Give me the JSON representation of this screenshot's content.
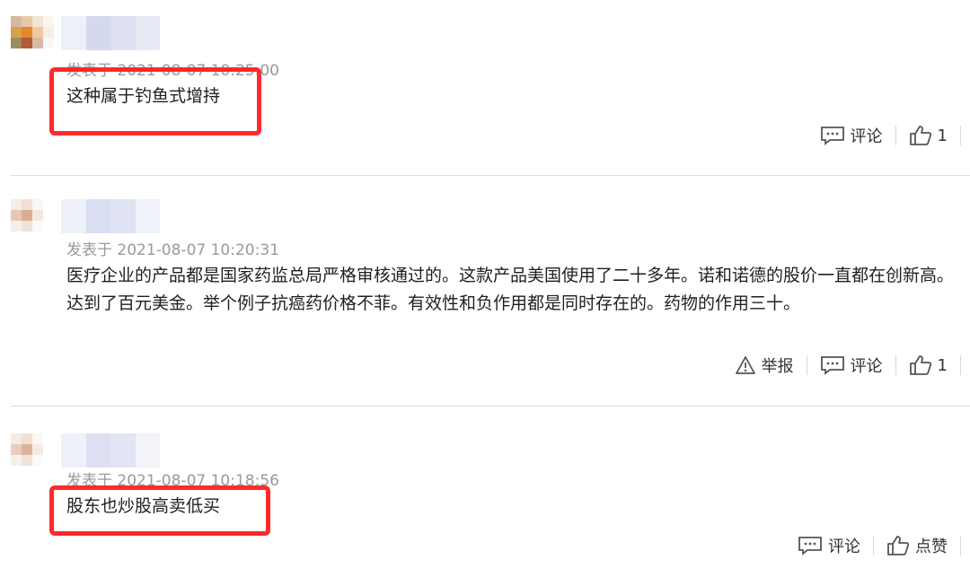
{
  "comments": [
    {
      "meta": "发表于 2021-08-07 10:25:00",
      "text": "这种属于钓鱼式增持",
      "actions": {
        "report": "",
        "comment": "评论",
        "like": "1"
      },
      "highlighted": true
    },
    {
      "meta": "发表于 2021-08-07 10:20:31",
      "text": "医疗企业的产品都是国家药监总局严格审核通过的。这款产品美国使用了二十多年。诺和诺德的股价一直都在创新高。达到了百元美金。举个例子抗癌药价格不菲。有效性和负作用都是同时存在的。药物的作用三十。",
      "actions": {
        "report": "举报",
        "comment": "评论",
        "like": "1"
      },
      "highlighted": false
    },
    {
      "meta": "发表于 2021-08-07 10:18:56",
      "text": "股东也炒股高卖低买",
      "actions": {
        "report": "",
        "comment": "评论",
        "like": "点赞"
      },
      "highlighted": true
    }
  ],
  "colors": {
    "highlight": "#ff2a2a",
    "divider": "#dcdcdc",
    "meta": "#9a9a9a"
  },
  "icons": {
    "comment": "comment-bubble-icon",
    "like": "thumbs-up-icon",
    "report": "warning-triangle-icon"
  }
}
